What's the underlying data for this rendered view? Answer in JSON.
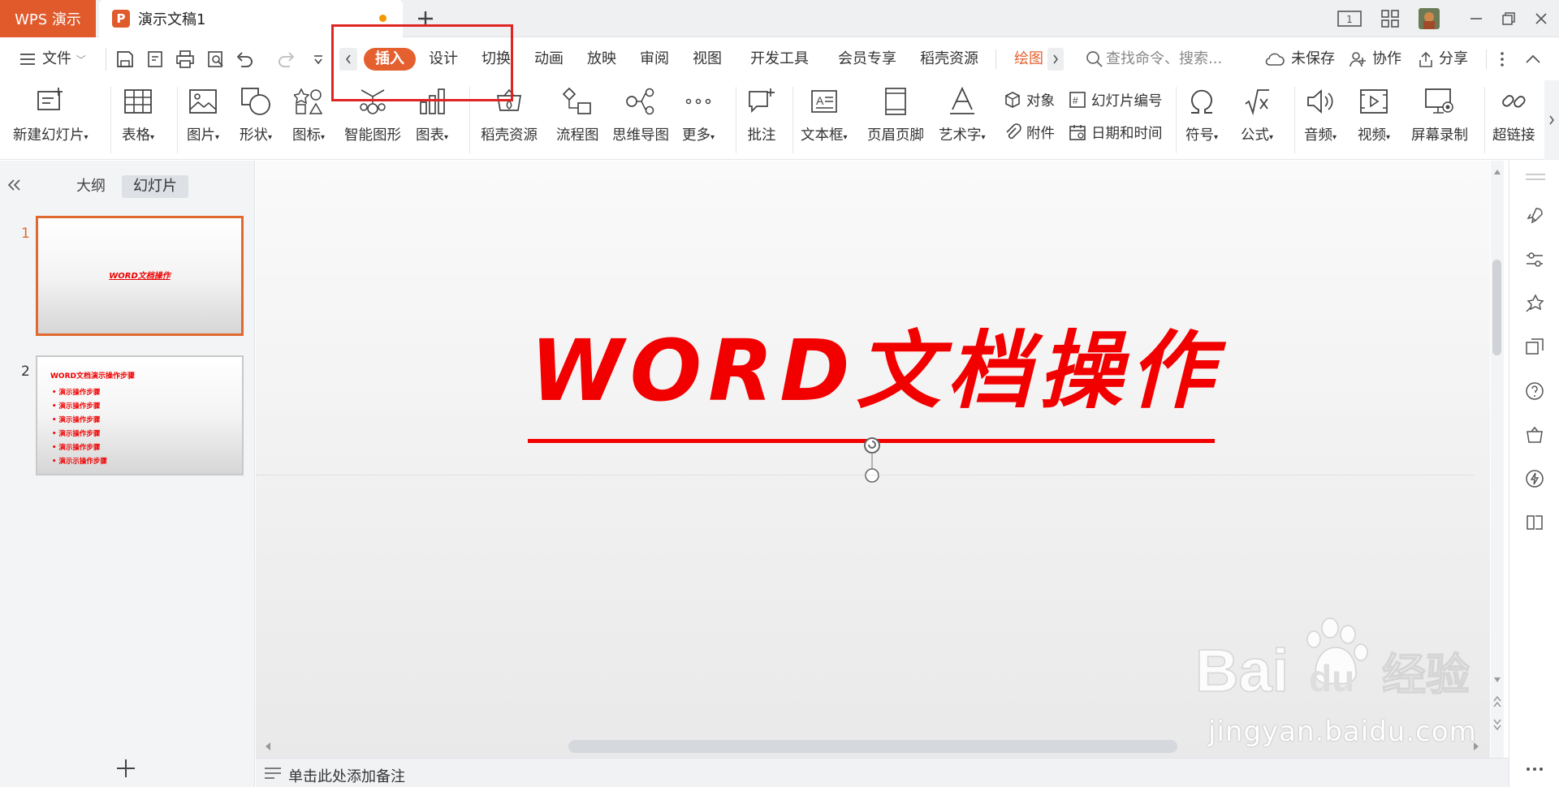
{
  "titlebar": {
    "app_name": "WPS 演示",
    "doc_title": "演示文稿1"
  },
  "menubar": {
    "file_label": "文件",
    "tabs": [
      "插入",
      "设计",
      "切换",
      "动画",
      "放映",
      "审阅",
      "视图",
      "开发工具",
      "会员专享",
      "稻壳资源",
      "绘图"
    ],
    "active_tab": "插入",
    "search_placeholder": "查找命令、搜索...",
    "unsaved_label": "未保存",
    "collab_label": "协作",
    "share_label": "分享"
  },
  "ribbon": {
    "new_slide": "新建幻灯片",
    "table": "表格",
    "picture": "图片",
    "shape": "形状",
    "icon": "图标",
    "smart_art": "智能图形",
    "chart": "图表",
    "docer": "稻壳资源",
    "flowchart": "流程图",
    "mindmap": "思维导图",
    "more": "更多",
    "comment": "批注",
    "textbox": "文本框",
    "header_footer": "页眉页脚",
    "word_art": "艺术字",
    "object": "对象",
    "slide_number": "幻灯片编号",
    "attachment": "附件",
    "date_time": "日期和时间",
    "symbol": "符号",
    "formula": "公式",
    "audio": "音频",
    "video": "视频",
    "screen_record": "屏幕录制",
    "hyperlink": "超链接"
  },
  "leftpanel": {
    "tab_outline": "大纲",
    "tab_slides": "幻灯片",
    "slides": [
      {
        "num": "1",
        "title": "WORD文档操作"
      },
      {
        "num": "2",
        "title": "WORD文档演示操作步骤",
        "bullets": [
          "演示操作步骤",
          "演示操作步骤",
          "演示操作步骤",
          "演示操作步骤",
          "演示操作步骤",
          "演示示操作步骤"
        ]
      }
    ]
  },
  "slide": {
    "title": "WORD文档操作"
  },
  "notes": {
    "placeholder": "单击此处添加备注"
  },
  "watermark": {
    "url": "jingyan.baidu.com"
  },
  "colors": {
    "accent": "#e5602f",
    "slide_text": "#f20000",
    "highlight_box": "#e02424"
  }
}
